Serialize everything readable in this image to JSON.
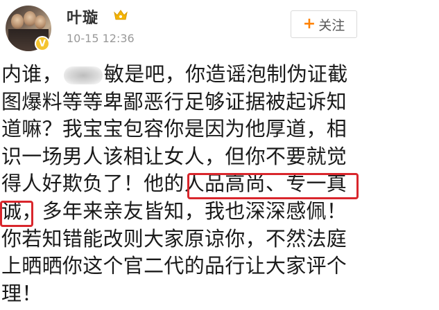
{
  "user": {
    "name": "叶璇",
    "timestamp": "10-15 12:36",
    "badge_icon": "verified-badge-icon",
    "vip_icon": "crown-icon",
    "badge_color": "#f4c430"
  },
  "follow_button": {
    "plus": "+",
    "label": "关注",
    "accent": "#ff8200"
  },
  "post": {
    "line1_before": "内谁，",
    "line1_after": "敏是吧，你造谣泡制伪证截",
    "line2": "图爆料等等卑鄙恶行足够证据被起诉知",
    "line3": "道嘛？我宝宝包容你是因为他厚道，相",
    "line4": "识一场男人该相让女人，但你不要就觉",
    "line5": "得人好欺负了！他的人品高尚、专一真",
    "line6": "诚，多年来亲友皆知，我也深深感佩！",
    "line7": "你若知错能改则大家原谅你，不然法庭",
    "line8": "上晒晒你这个官二代的品行让大家评个",
    "line9": "理！"
  },
  "highlight_color": "#d9262c"
}
